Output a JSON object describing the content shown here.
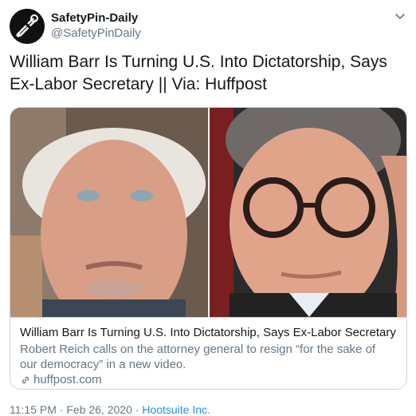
{
  "author": {
    "display_name": "SafetyPin-Daily",
    "handle": "@SafetyPinDaily",
    "avatar_icon": "safety-pin-logo"
  },
  "tweet": {
    "text": "William Barr Is Turning U.S. Into Dictatorship, Says Ex-Labor Secretary || Via: Huffpost"
  },
  "card": {
    "left_image": "photo of older man with white hair speaking",
    "right_image": "photo of man in glasses with hand on face",
    "title": "William Barr Is Turning U.S. Into Dictatorship, Says Ex-Labor Secretary",
    "description": "Robert Reich calls on the attorney general to resign “for the sake of our democracy” in a new video.",
    "domain": "huffpost.com",
    "link_icon": "link-icon"
  },
  "meta": {
    "time": "11:15 PM",
    "separator": "·",
    "date": "Feb 26, 2020",
    "source": "Hootsuite Inc."
  },
  "colors": {
    "text_primary": "#14171a",
    "text_secondary": "#657786",
    "link": "#1b95e0",
    "border": "#ccd6dd"
  }
}
